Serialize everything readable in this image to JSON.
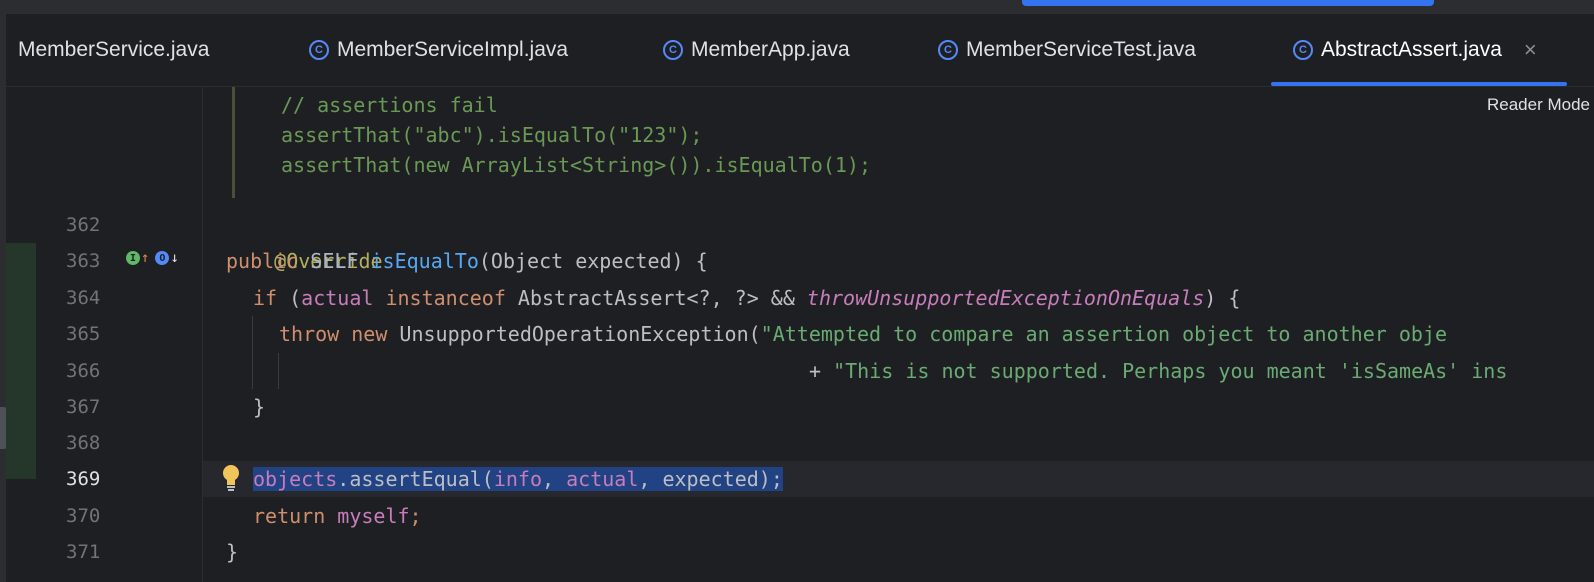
{
  "tabs": [
    {
      "label": "MemberService.java",
      "icon": null,
      "active": false
    },
    {
      "label": "MemberServiceImpl.java",
      "icon": "class-icon",
      "active": false
    },
    {
      "label": "MemberApp.java",
      "icon": "class-icon",
      "active": false
    },
    {
      "label": "MemberServiceTest.java",
      "icon": "class-icon",
      "active": false
    },
    {
      "label": "AbstractAssert.java",
      "icon": "class-icon",
      "active": true
    }
  ],
  "tab_close": "×",
  "class_icon_glyph": "C",
  "reader_mode": "Reader Mode",
  "doc_comment": [
    "// assertions fail",
    "assertThat(\"abc\").isEqualTo(\"123\");",
    "assertThat(new ArrayList<String>()).isEqualTo(1);"
  ],
  "line_numbers": [
    "362",
    "363",
    "364",
    "365",
    "366",
    "367",
    "368",
    "369",
    "370",
    "371"
  ],
  "current_line": "369",
  "gutter_icons": {
    "implements": "I",
    "overrides": "O"
  },
  "code": {
    "l362": {
      "annotation": "@Override"
    },
    "l363": {
      "kw_public": "public ",
      "type_self": "SELF ",
      "method": "isEqualTo",
      "rest": "(Object expected) {"
    },
    "l364": {
      "kw_if": "if ",
      "p1": "(",
      "field_actual": "actual",
      "kw_instanceof": " instanceof ",
      "type": "AbstractAssert<?, ?>",
      "op": " && ",
      "ifield": "throwUnsupportedExceptionOnEquals",
      "end": ") {"
    },
    "l365": {
      "kw_throw": "throw ",
      "kw_new": "new ",
      "type": "UnsupportedOperationException(",
      "str": "\"Attempted to compare an assertion object to another obje"
    },
    "l366": {
      "plus": "+ ",
      "str": "\"This is not supported. Perhaps you meant 'isSameAs' ins"
    },
    "l367": {
      "brace": "}"
    },
    "l369": {
      "field_objects": "objects",
      "dot": ".",
      "call": "assertEqual(",
      "a1": "info",
      "c1": ", ",
      "a2": "actual",
      "c2": ", ",
      "a3": "expected",
      "end": ");"
    },
    "l370": {
      "kw_return": "return ",
      "field_myself": "myself",
      "end": ";"
    },
    "l371": {
      "brace": "}"
    }
  }
}
